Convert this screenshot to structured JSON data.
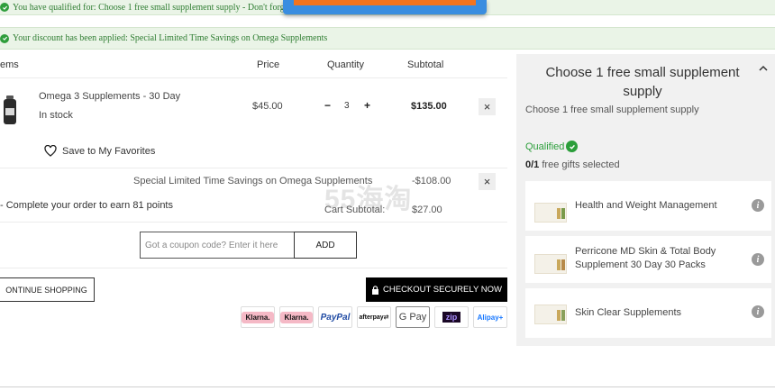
{
  "banners": {
    "qualified_text": "You have qualified for: Choose 1 free small supplement supply - Don't forg",
    "discount_text": "Your discount has been applied: Special Limited Time Savings on Omega Supplements"
  },
  "columns": {
    "items": "ems",
    "price": "Price",
    "quantity": "Quantity",
    "subtotal": "Subtotal"
  },
  "product": {
    "name": "Omega 3 Supplements - 30 Day",
    "stock": "In stock",
    "price": "$45.00",
    "qty_minus": "−",
    "qty": "3",
    "qty_plus": "+",
    "subtotal": "$135.00",
    "remove": "×",
    "favorites": "Save to My Favorites"
  },
  "promo": {
    "label": "Special Limited Time Savings on Omega Supplements",
    "value": "-$108.00",
    "remove": "×"
  },
  "points_text": "-  Complete your order to earn 81 points",
  "cart_subtotal": {
    "label": "Cart Subtotal:",
    "value": "$27.00"
  },
  "watermark": "55海淘",
  "coupon": {
    "placeholder": "Got a coupon code? Enter it here",
    "button": "ADD"
  },
  "actions": {
    "continue": "ONTINUE SHOPPING",
    "checkout": "CHECKOUT SECURELY NOW"
  },
  "payments": {
    "klarna": "Klarna.",
    "paypal": "PayPal",
    "afterpay": "afterpay⇄",
    "gpay": "G Pay",
    "zip": "zip",
    "alipay": "Alipay+"
  },
  "side": {
    "title": "Choose 1 free small supplement supply",
    "desc": "Choose 1 free small supplement supply",
    "qualified": "Qualified",
    "gifts_count": "0/1",
    "gifts_text": " free gifts selected",
    "gifts": [
      {
        "name": "Health and Weight Management"
      },
      {
        "name": "Perricone MD Skin & Total Body Supplement 30 Day 30 Packs"
      },
      {
        "name": "Skin Clear Supplements"
      }
    ]
  },
  "colors": {
    "banner_bg": "#eaf4e7",
    "banner_text": "#2f7d32",
    "qualified_green": "#2b9e3a",
    "checkout_bg": "#000000",
    "sidebar_bg": "#f1f1f1"
  }
}
